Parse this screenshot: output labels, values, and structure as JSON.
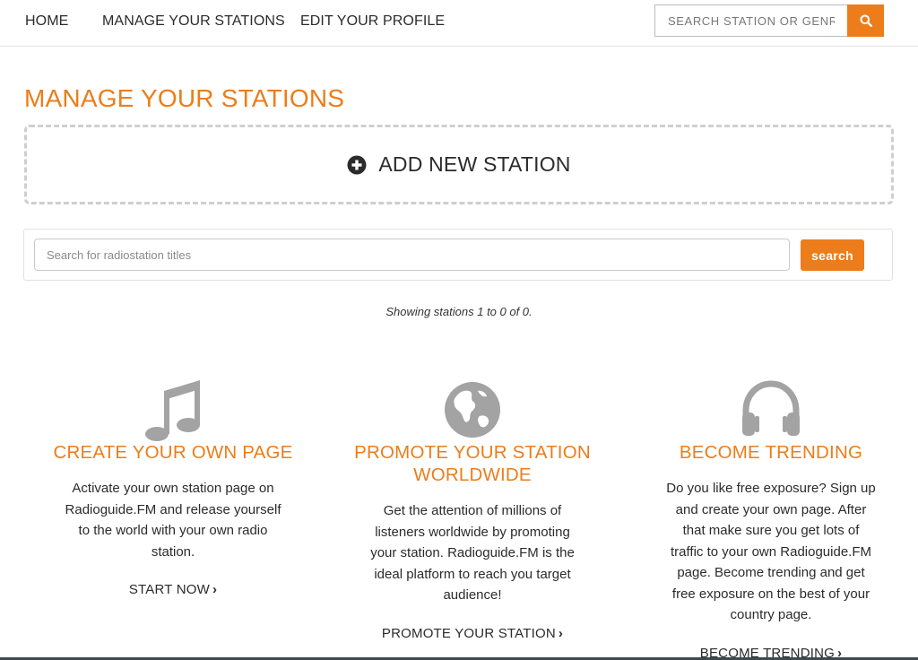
{
  "nav": {
    "home": "HOME",
    "manage": "MANAGE YOUR STATIONS",
    "edit_profile": "EDIT YOUR PROFILE",
    "search_placeholder": "SEARCH STATION OR GENRE",
    "search_icon": "search-icon"
  },
  "main": {
    "title": "MANAGE YOUR STATIONS",
    "add_station_label": "ADD NEW STATION",
    "add_station_icon": "plus-circle-icon",
    "station_search_placeholder": "Search for radiostation titles",
    "station_search_button": "search",
    "showing_text": "Showing stations 1 to 0 of 0."
  },
  "features": [
    {
      "icon": "music-note-icon",
      "title_lines": [
        "CREATE YOUR OWN PAGE"
      ],
      "text_lines": [
        "Activate your own station page on",
        "Radioguide.FM and release yourself",
        "to the world with your own radio",
        "station."
      ],
      "cta": "START NOW",
      "cta_chevron": "›"
    },
    {
      "icon": "globe-icon",
      "title_lines": [
        "PROMOTE YOUR STATION",
        "WORLDWIDE"
      ],
      "text_lines": [
        "Get the attention of millions of",
        "listeners worldwide by promoting",
        "your station. Radioguide.FM is the",
        "ideal platform to reach you target",
        "audience!"
      ],
      "cta": "PROMOTE YOUR STATION",
      "cta_chevron": "›"
    },
    {
      "icon": "headphones-icon",
      "title_lines": [
        "BECOME TRENDING"
      ],
      "text_lines": [
        "Do you like free exposure? Sign up",
        "and create your own page. After",
        "that make sure you get lots of",
        "traffic to your own Radioguide.FM",
        "page. Become trending and get",
        "free exposure on the best of your",
        "country page."
      ],
      "cta": "BECOME TRENDING",
      "cta_chevron": "›"
    }
  ],
  "colors": {
    "accent": "#ec7d1a",
    "icon_gray": "#a3a3a3",
    "text": "#2b2b2b"
  }
}
